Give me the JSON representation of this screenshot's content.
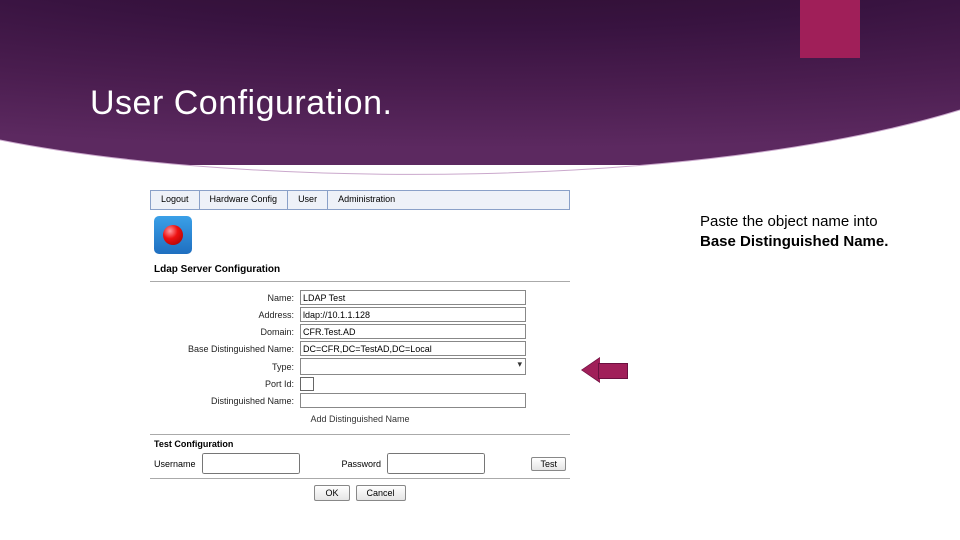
{
  "slide": {
    "title": "User Configuration."
  },
  "menu": {
    "logout": "Logout",
    "hardware": "Hardware Config",
    "user": "User",
    "admin": "Administration"
  },
  "ldap": {
    "section": "Ldap Server Configuration",
    "name_label": "Name:",
    "name_value": "LDAP Test",
    "address_label": "Address:",
    "address_value": "ldap://10.1.1.128",
    "domain_label": "Domain:",
    "domain_value": "CFR.Test.AD",
    "bdn_label": "Base Distinguished Name:",
    "bdn_value": "DC=CFR,DC=TestAD,DC=Local",
    "type_label": "Type:",
    "portid_label": "Port Id:",
    "dn_label": "Distinguished Name:",
    "add_dn": "Add Distinguished Name"
  },
  "test": {
    "section": "Test Configuration",
    "username_label": "Username",
    "password_label": "Password",
    "test_btn": "Test"
  },
  "buttons": {
    "ok": "OK",
    "cancel": "Cancel"
  },
  "callout": {
    "line1": "Paste the object name into",
    "line2": "Base Distinguished Name."
  }
}
